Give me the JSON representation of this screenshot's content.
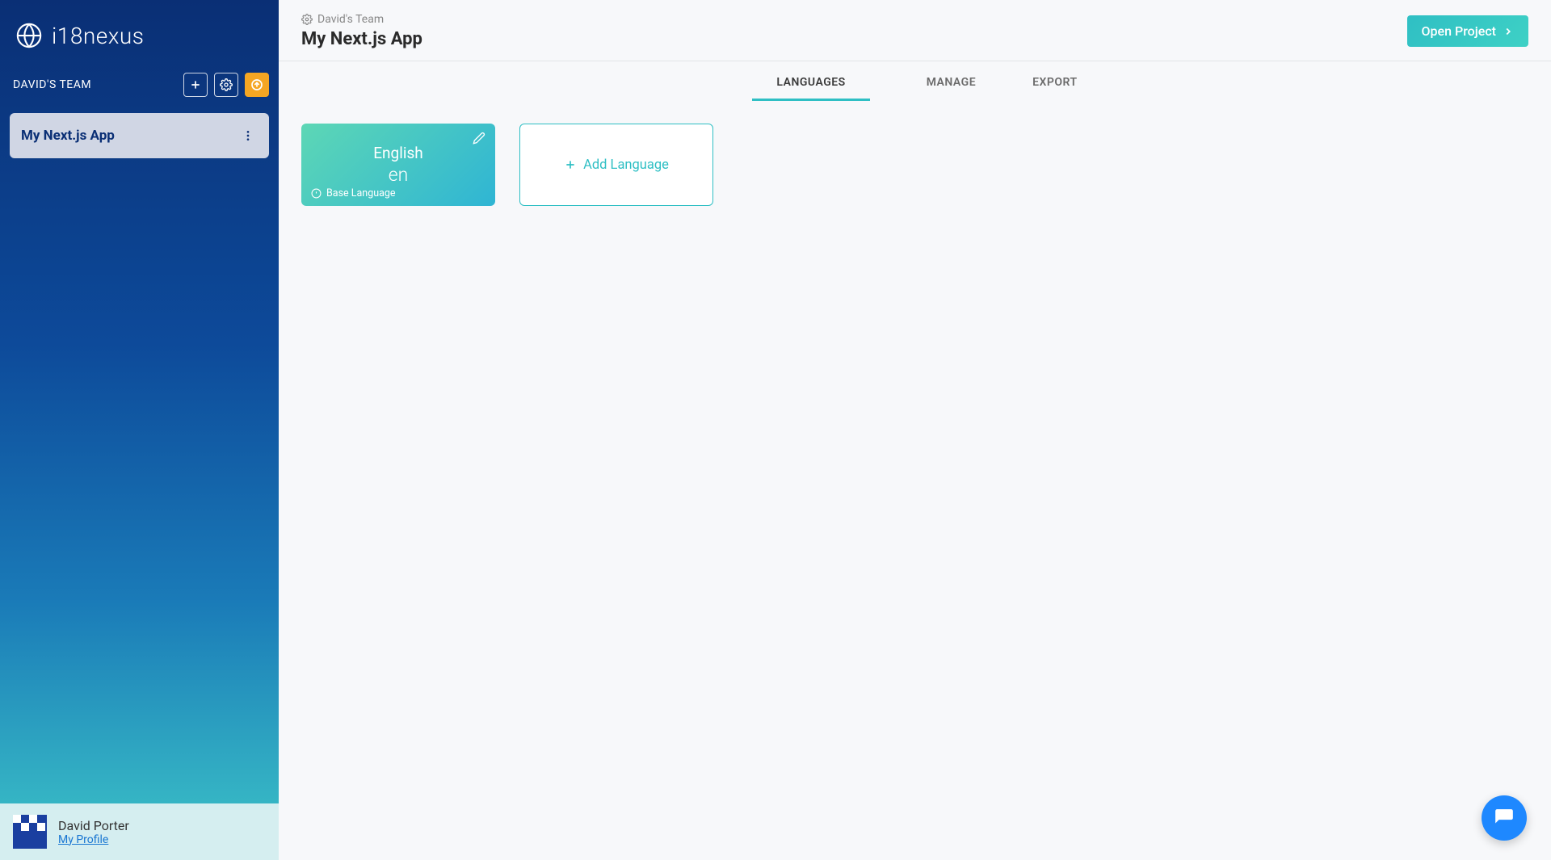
{
  "brand": {
    "name": "i18nexus"
  },
  "sidebar": {
    "team_label": "DAVID'S TEAM",
    "projects": [
      {
        "name": "My Next.js App"
      }
    ],
    "user": {
      "name": "David Porter",
      "profile_link": "My Profile"
    }
  },
  "header": {
    "breadcrumb_team": "David's Team",
    "title": "My Next.js App",
    "open_project_label": "Open Project"
  },
  "tabs": [
    {
      "label": "LANGUAGES",
      "active": true
    },
    {
      "label": "MANAGE",
      "active": false
    },
    {
      "label": "EXPORT",
      "active": false
    }
  ],
  "languages": {
    "cards": [
      {
        "name": "English",
        "code": "en",
        "base_label": "Base Language"
      }
    ],
    "add_label": "Add Language"
  }
}
